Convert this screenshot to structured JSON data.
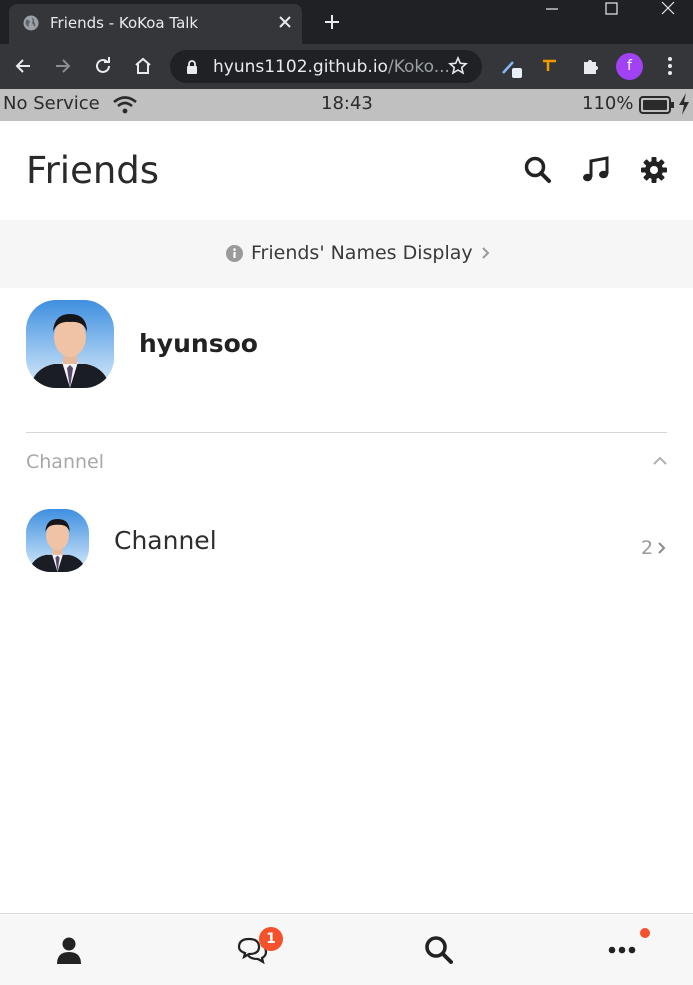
{
  "browser": {
    "tab_title": "Friends - KoKoa Talk",
    "url_host": "hyuns1102.github.io",
    "url_rest": "/Koko...",
    "profile_initial": "f"
  },
  "status_bar": {
    "carrier": "No Service",
    "time": "18:43",
    "battery": "110%"
  },
  "header": {
    "title": "Friends",
    "icons": [
      "search-icon",
      "music-icon",
      "settings-icon"
    ]
  },
  "notice": {
    "text": "Friends' Names Display"
  },
  "my_profile": {
    "name": "hyunsoo"
  },
  "channel_section": {
    "label": "Channel",
    "item": {
      "name": "Channel",
      "count": "2"
    }
  },
  "bottom_nav": {
    "items": [
      "friends-icon",
      "chats-icon",
      "find-icon",
      "more-icon"
    ],
    "chat_badge": "1"
  },
  "colors": {
    "badge": "#f4512c",
    "status_bar": "#c0c0c0",
    "chrome_dark": "#202124"
  }
}
